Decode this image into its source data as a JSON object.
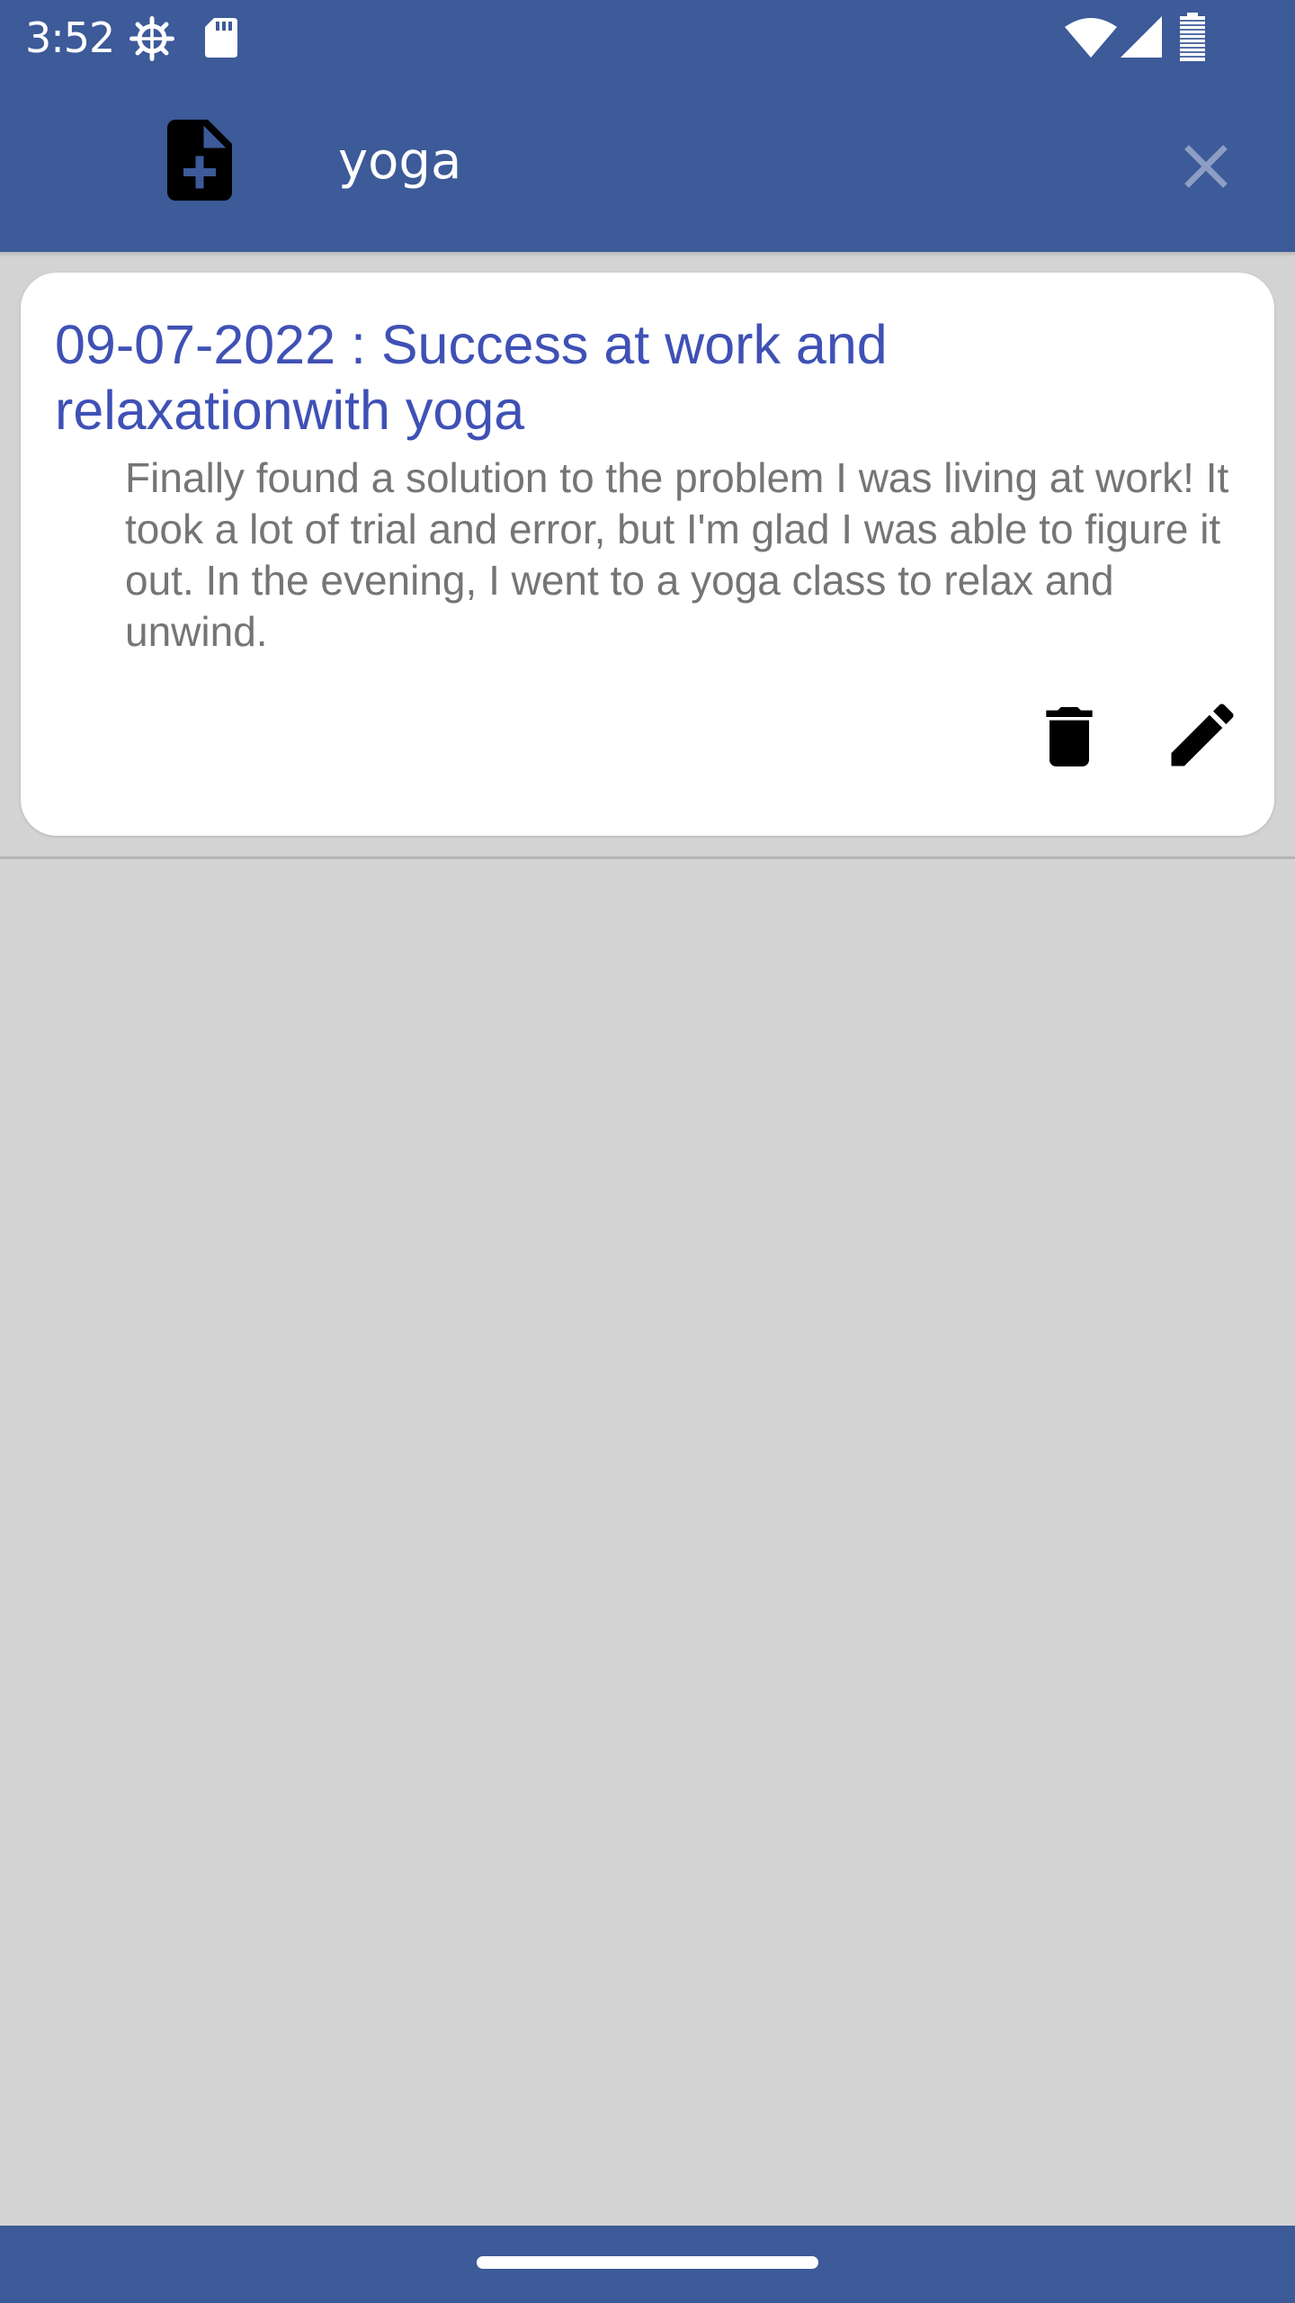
{
  "status_bar": {
    "time": "3:52",
    "icons": [
      "settings-gear-icon",
      "sd-card-icon",
      "wifi-icon",
      "cell-signal-icon",
      "battery-icon"
    ]
  },
  "app_bar": {
    "left_icon": "note-add-icon",
    "search_value": "yoga",
    "clear_icon": "close-icon"
  },
  "note": {
    "title": "09-07-2022 : Success at work and relaxationwith yoga",
    "body": "Finally found a solution to the problem I was living at work! It took a lot of trial and error, but I'm glad I was able to figure it out. In the evening, I went to a yoga class to relax and unwind.",
    "actions": [
      "delete-icon",
      "edit-icon"
    ]
  },
  "colors": {
    "primary": "#3d5a99",
    "title_text": "#3f51b5",
    "body_text": "#757575",
    "background": "#d3d3d3",
    "card": "#ffffff"
  }
}
